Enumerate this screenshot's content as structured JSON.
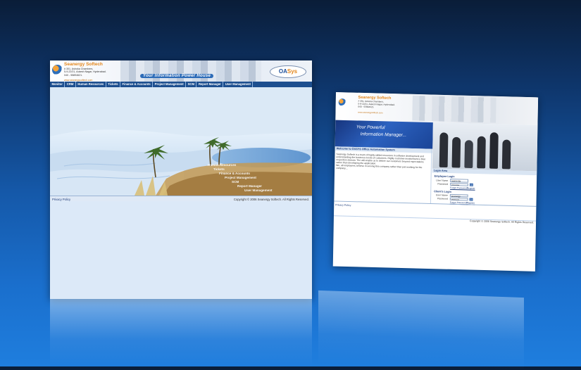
{
  "colors": {
    "accent_orange": "#e3861b",
    "nav_blue": "#1d4f8f",
    "link_blue": "#1b3b7a",
    "background_top": "#0a1d38",
    "background_bottom": "#1f7ede"
  },
  "left_screen": {
    "company_name": "Seanergy Softech",
    "address": "# 301, Ashoka Chambers,\n5-9-22/21, Adarsh Nagar, Hyderabad.\n040 - 55894621.",
    "website": "www.seanergysoftech.com",
    "tagline": "Your Information Power House",
    "product_logo_a": "OA",
    "product_logo_b": "Sys",
    "nav_items": [
      "Monitor",
      "CRM",
      "Human Resources",
      "Tickets",
      "Finance & Accounts",
      "Project Management",
      "SCM",
      "Report Manager",
      "User Management"
    ],
    "footer_link": "Privacy Policy",
    "copyright": "Copyright © 2006 Seanergy Softech. All Rights Reserved."
  },
  "right_screen": {
    "company_name": "Seanergy Softech",
    "address": "# 301, Ashoka Chambers,\n5-9-22/21, Adarsh Nagar, Hyderabad.\n040 - 55894621.",
    "website": "www.seanergysoftech.com",
    "banner_line1": "Your Powerful",
    "banner_line2": "Information Manager...",
    "welcome_title": "Welcome to OASYS Office Automation System",
    "intro_text": "Seanergy Softech is a team of highly skilled resources in software development and understanding the business needs of customers. Highly customer involvement is their respective domain. The will enable us to deliver our customers beyond expectations rather than developing the application.",
    "intro_text2": "We, all employees, believe in serving this company rather than just working for the company....",
    "login_area_title": "Login Area",
    "employee_login_title": "Employee Login",
    "clients_login_title": "Client's Login",
    "user_name_label": "User Name",
    "password_label": "Password",
    "employee_username_value": "seanergy",
    "employee_password_value": "••••••••••",
    "client_username_value": "seanergy",
    "client_password_value": "••••••••••",
    "go_label": "Go",
    "forgot_password": "Forgot Password?",
    "register": "Register",
    "footer_link": "Privacy Policy",
    "copyright": "Copyright © 2006 Seanergy Softech. All Rights Reserved."
  }
}
